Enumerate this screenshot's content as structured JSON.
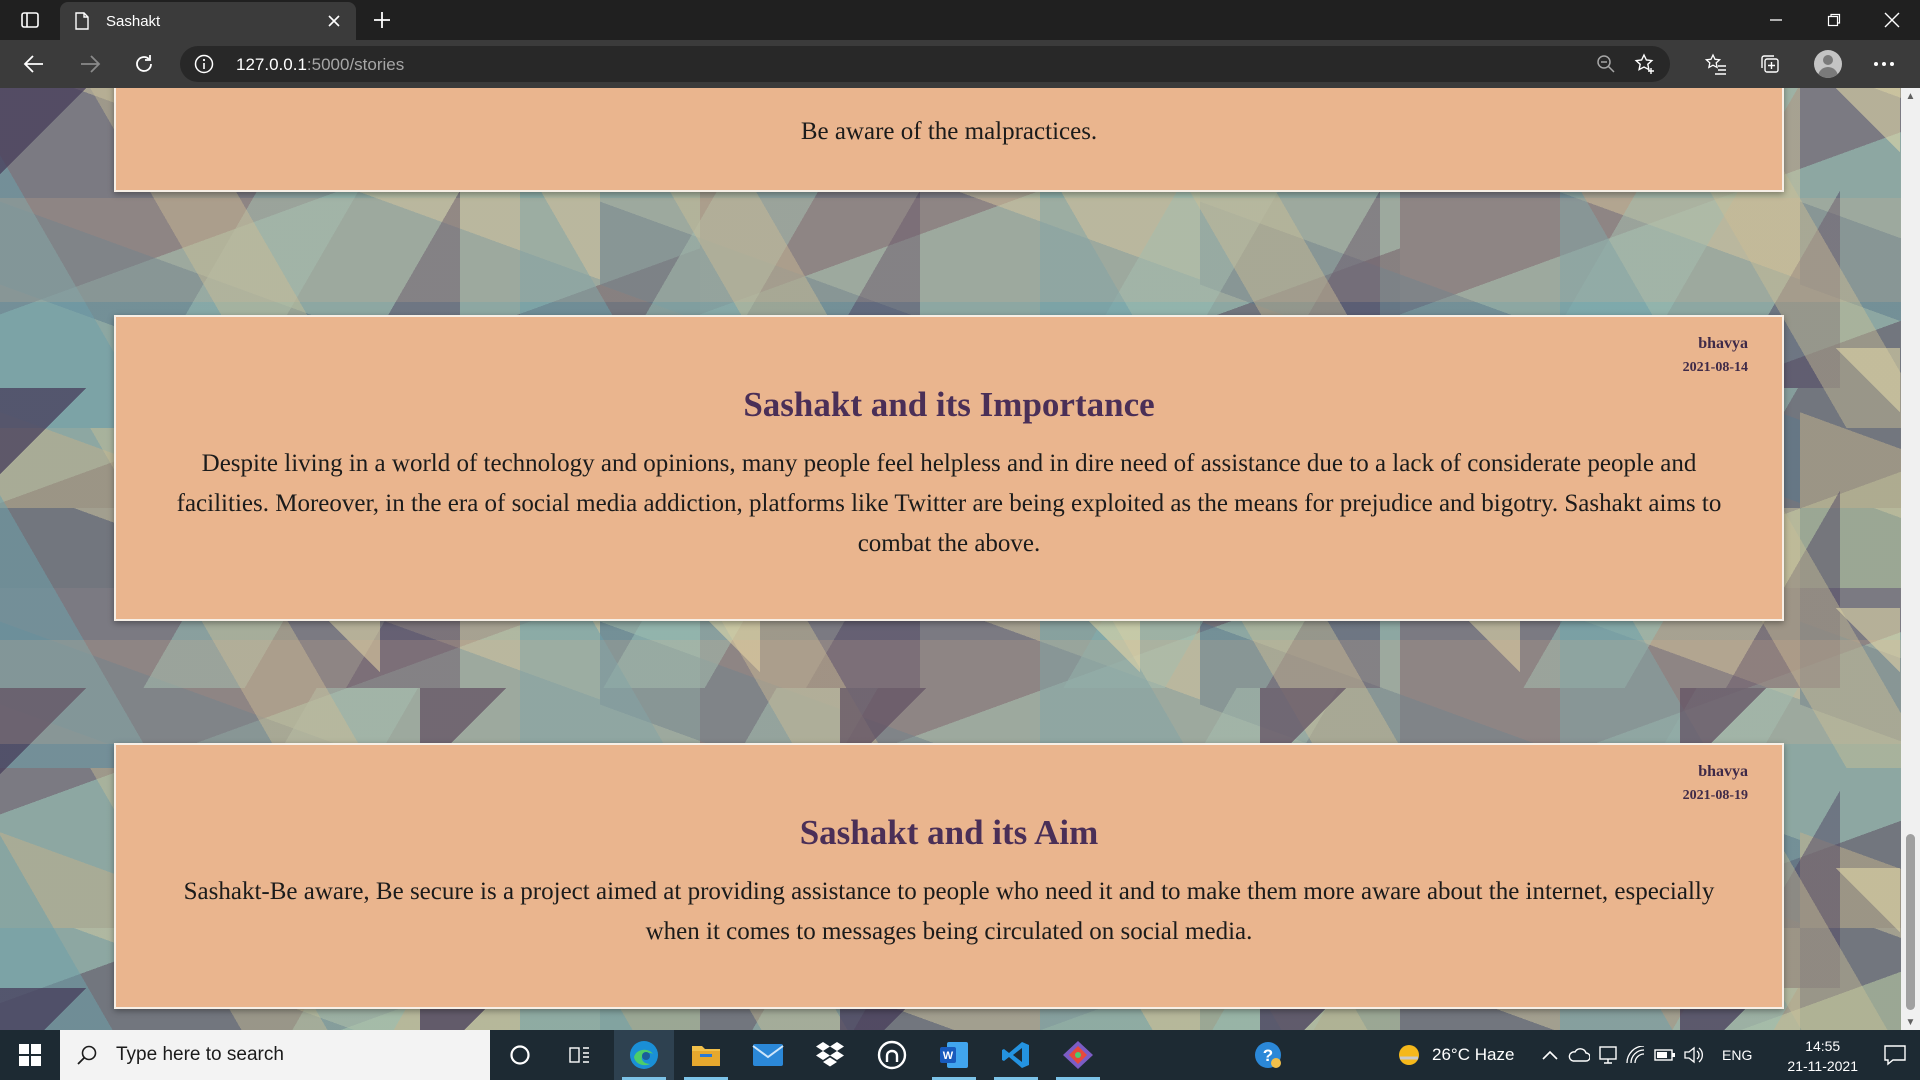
{
  "browser": {
    "tab_title": "Sashakt",
    "url_host": "127.0.0.1",
    "url_path": ":5000/stories"
  },
  "stories": [
    {
      "body": "Be aware of the malpractices."
    },
    {
      "author": "bhavya",
      "date": "2021-08-14",
      "title": "Sashakt and its Importance",
      "body": "Despite living in a world of technology and opinions, many people feel helpless and in dire need of assistance due to a lack of considerate people and facilities. Moreover, in the era of social media addiction, platforms like Twitter are being exploited as the means for prejudice and bigotry. Sashakt aims to combat the above."
    },
    {
      "author": "bhavya",
      "date": "2021-08-19",
      "title": "Sashakt and its Aim",
      "body": "Sashakt-Be aware, Be secure is a project aimed at providing assistance to people who need it and to make them more aware about the internet, especially when it comes to messages being circulated on social media."
    }
  ],
  "taskbar": {
    "search_placeholder": "Type here to search",
    "weather": "26°C  Haze",
    "language": "ENG",
    "time": "14:55",
    "date": "21-11-2021"
  },
  "colors": {
    "card_bg": "#eab58e",
    "title_color": "#4a2f57",
    "chrome_dark": "#202020",
    "taskbar": "#1d2a33"
  }
}
